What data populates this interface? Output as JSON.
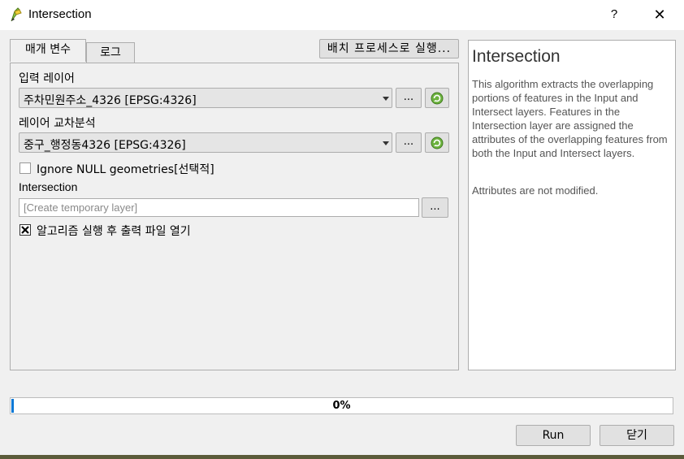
{
  "window": {
    "title": "Intersection",
    "help_label": "?",
    "close_label": "✕"
  },
  "tabs": [
    {
      "label": "매개 변수",
      "active": true
    },
    {
      "label": "로그",
      "active": false
    }
  ],
  "batch_button_label": "배치 프로세스로 실행...",
  "params": {
    "input_layer": {
      "label": "입력 레이어",
      "value": "주차민원주소_4326 [EPSG:4326]",
      "browse_label": "..."
    },
    "overlay_layer": {
      "label": "레이어 교차분석",
      "value": "중구_행정동4326 [EPSG:4326]",
      "browse_label": "..."
    },
    "ignore_null": {
      "label": "Ignore NULL geometries[선택적]",
      "checked": false
    },
    "output": {
      "label": "Intersection",
      "placeholder": "[Create temporary layer]",
      "value": "",
      "browse_label": "..."
    },
    "open_output": {
      "label": "알고리즘 실행 후 출력 파일 열기",
      "checked": true
    }
  },
  "help": {
    "title": "Intersection",
    "paragraph1": "This algorithm extracts the overlapping portions of features in the Input and Intersect layers. Features in the Intersection layer are assigned the attributes of the overlapping features from both the Input and Intersect layers.",
    "paragraph2": "Attributes are not modified."
  },
  "progress": {
    "value": 0,
    "text": "0%"
  },
  "buttons": {
    "run": "Run",
    "close": "닫기"
  },
  "icons": {
    "app": "qgis-pencil-icon",
    "iterate": "iterate-icon"
  },
  "colors": {
    "accent": "#0678d6",
    "iterate_green": "#5aa02c"
  }
}
